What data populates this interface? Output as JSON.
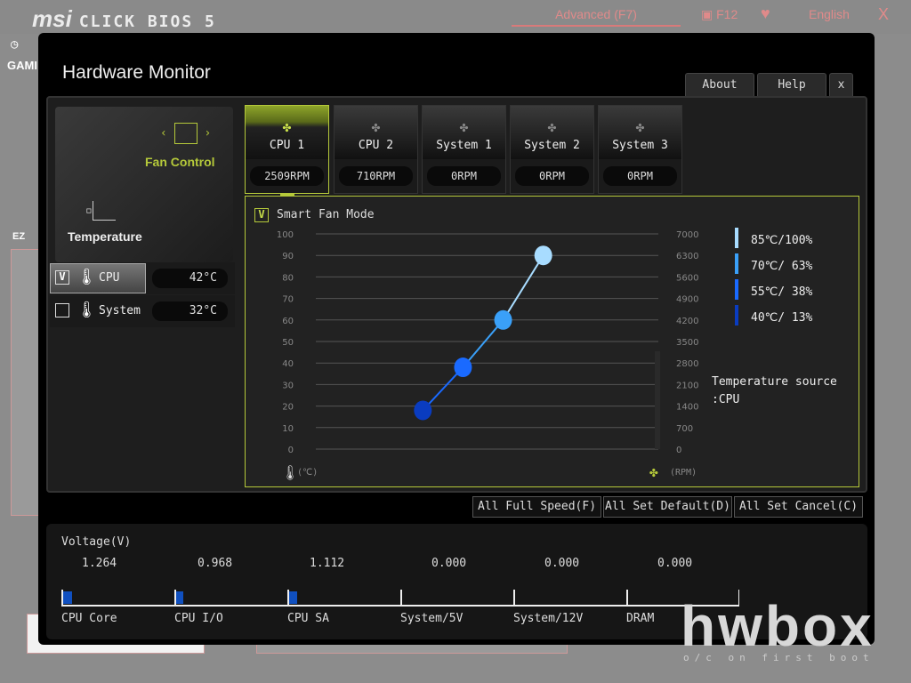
{
  "bios": {
    "brand": "msi",
    "product": "CLICK BIOS 5",
    "mode_button": "Advanced (F7)",
    "screenshot_key": "F12",
    "language": "English",
    "close": "X",
    "side_tab": "GAMI",
    "ez_label": "EZ"
  },
  "modal": {
    "title": "Hardware Monitor",
    "about": "About",
    "help": "Help",
    "close": "x"
  },
  "left": {
    "fan_control": "Fan Control",
    "temperature": "Temperature",
    "sensors": [
      {
        "name": "CPU",
        "value": "42°C",
        "checked": true,
        "check_mark": "V"
      },
      {
        "name": "System",
        "value": "32°C",
        "checked": false,
        "check_mark": ""
      }
    ]
  },
  "fans": [
    {
      "name": "CPU 1",
      "rpm": "2509RPM",
      "active": true
    },
    {
      "name": "CPU 2",
      "rpm": "710RPM"
    },
    {
      "name": "System 1",
      "rpm": "0RPM"
    },
    {
      "name": "System 2",
      "rpm": "0RPM"
    },
    {
      "name": "System 3",
      "rpm": "0RPM"
    }
  ],
  "smart_fan": {
    "label": "Smart Fan Mode",
    "check_mark": "V",
    "temp_unit": "(℃)",
    "rpm_unit": "(RPM)",
    "source_label": "Temperature source",
    "source_value": ":CPU"
  },
  "chart_data": {
    "type": "line",
    "ylim": [
      0,
      100
    ],
    "y2lim": [
      0,
      7000
    ],
    "yticks": [
      "100",
      "90",
      "80",
      "70",
      "60",
      "50",
      "40",
      "30",
      "20",
      "10",
      "0"
    ],
    "y2ticks": [
      "7000",
      "6300",
      "5600",
      "4900",
      "4200",
      "3500",
      "2800",
      "2100",
      "1400",
      "700",
      "0"
    ],
    "xlim": [
      0,
      128
    ],
    "grid": true,
    "points": [
      {
        "x": 40,
        "y": 18,
        "color": "#0a3cc0"
      },
      {
        "x": 55,
        "y": 38,
        "color": "#1a6aff"
      },
      {
        "x": 70,
        "y": 60,
        "color": "#3aa0f8"
      },
      {
        "x": 85,
        "y": 90,
        "color": "#a8dcff"
      }
    ],
    "legend": [
      {
        "label": "85℃/100%",
        "color": "#a8dcff"
      },
      {
        "label": "70℃/ 63%",
        "color": "#3aa0f8"
      },
      {
        "label": "55℃/ 38%",
        "color": "#1a6aff"
      },
      {
        "label": "40℃/ 13%",
        "color": "#0a3cc0"
      }
    ],
    "legend_placement": "right"
  },
  "actions": [
    "All Full Speed(F)",
    "All Set Default(D)",
    "All Set Cancel(C)"
  ],
  "voltage": {
    "title": "Voltage(V)",
    "items": [
      {
        "name": "CPU Core",
        "value": "1.264"
      },
      {
        "name": "CPU I/O",
        "value": "0.968"
      },
      {
        "name": "CPU SA",
        "value": "1.112"
      },
      {
        "name": "System/5V",
        "value": "0.000"
      },
      {
        "name": "System/12V",
        "value": "0.000"
      },
      {
        "name": "DRAM",
        "value": "0.000"
      }
    ],
    "bar_color": "#1050c0"
  },
  "watermark": {
    "text": "hwbox",
    "tagline": "o/c on first boot"
  }
}
